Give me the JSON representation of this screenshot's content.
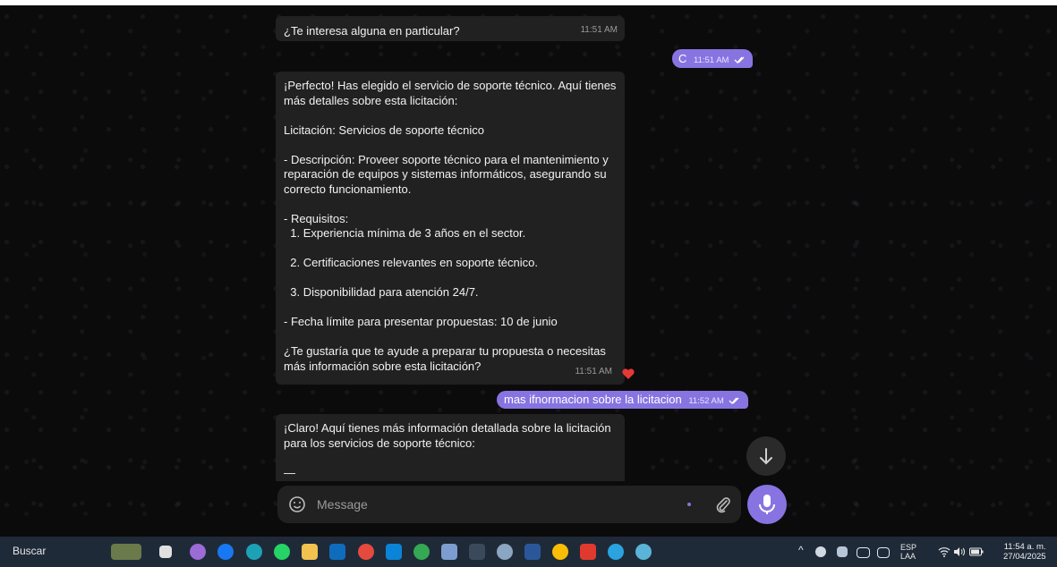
{
  "messages": {
    "m1_text": "¿Te interesa alguna en particular?",
    "m1_time": "11:51 AM",
    "m2_text": "C",
    "m2_time": "11:51 AM",
    "m3_text": "¡Perfecto! Has elegido el servicio de soporte técnico. Aquí tienes\nmás detalles sobre esta licitación:\n\nLicitación: Servicios de soporte técnico\n\n- Descripción: Proveer soporte técnico para el mantenimiento y\nreparación de equipos y sistemas informáticos, asegurando su\ncorrecto funcionamiento.\n\n- Requisitos:\n  1. Experiencia mínima de 3 años en el sector.\n\n  2. Certificaciones relevantes en soporte técnico.\n\n  3. Disponibilidad para atención 24/7.\n\n- Fecha límite para presentar propuestas: 10 de junio\n\n¿Te gustaría que te ayude a preparar tu propuesta o necesitas\nmás información sobre esta licitación?",
    "m3_time": "11:51 AM",
    "m4_text": "mas ifnormacion sobre la licitacion",
    "m4_time": "11:52 AM",
    "m5_text": "¡Claro! Aquí tienes más información detallada sobre la licitación\npara los servicios de soporte técnico:\n\n—"
  },
  "composer": {
    "placeholder": "Message"
  },
  "taskbar": {
    "search_label": "Buscar",
    "lang_top": "ESP",
    "lang_bottom": "LAA",
    "clock_time": "11:54 a. m.",
    "clock_date": "27/04/2025"
  },
  "colors": {
    "accent": "#8774e1",
    "incoming_bubble": "#212121",
    "heart": "#e53935"
  }
}
